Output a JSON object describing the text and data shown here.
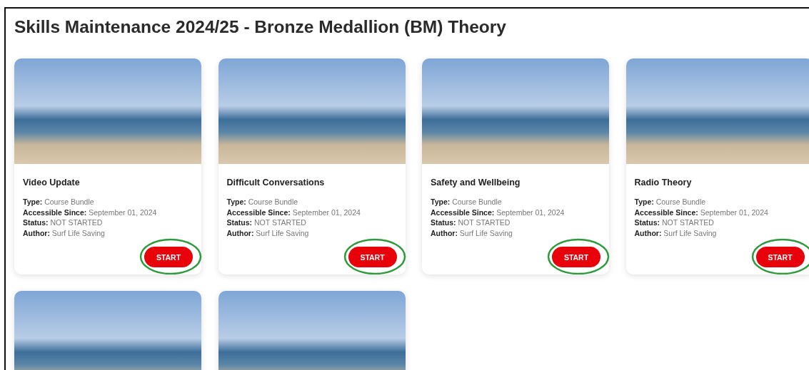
{
  "page": {
    "title": "Skills Maintenance 2024/25 - Bronze Medallion (BM) Theory"
  },
  "cards": [
    {
      "kind": "course",
      "title": "Video Update",
      "meta": [
        "**Type:** Course Bundle",
        "**Accessible Since:** September 01, 2024",
        "**Status:** NOT STARTED",
        "**Author:** Surf Life Saving"
      ],
      "button": "START",
      "highlighted": true
    },
    {
      "kind": "course",
      "title": "Difficult Conversations",
      "meta": [
        "**Type:** Course Bundle",
        "**Accessible Since:** September 01, 2024",
        "**Status:** NOT STARTED",
        "**Author:** Surf Life Saving"
      ],
      "button": "START",
      "highlighted": true
    },
    {
      "kind": "course",
      "title": "Safety and Wellbeing",
      "meta": [
        "**Type:** Course Bundle",
        "**Accessible Since:** September 01, 2024",
        "**Status:** NOT STARTED",
        "**Author:** Surf Life Saving"
      ],
      "button": "START",
      "highlighted": true
    },
    {
      "kind": "course",
      "title": "Radio Theory",
      "meta": [
        "**Type:** Course Bundle",
        "**Accessible Since:** September 01, 2024",
        "**Status:** NOT STARTED",
        "**Author:** Surf Life Saving"
      ],
      "button": "START",
      "highlighted": true
    },
    {
      "kind": "photo"
    },
    {
      "kind": "photo"
    }
  ]
}
